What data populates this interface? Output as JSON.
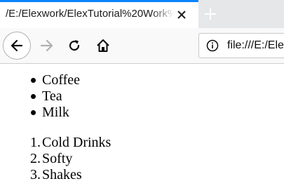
{
  "tab": {
    "title": "/E:/Elexwork/ElexTutorial%20Work%"
  },
  "urlbar": {
    "text": "file:///E:/Ele"
  },
  "page": {
    "unordered_list": [
      "Coffee",
      "Tea",
      "Milk"
    ],
    "ordered_list": [
      {
        "marker": "1.",
        "text": "Cold Drinks"
      },
      {
        "marker": "2.",
        "text": "Softy"
      },
      {
        "marker": "3.",
        "text": "Shakes"
      }
    ]
  },
  "icons": {
    "close": "close-icon",
    "new_tab": "plus-icon",
    "back": "arrow-left-icon",
    "forward": "arrow-right-icon",
    "reload": "reload-icon",
    "home": "home-icon",
    "info": "info-icon"
  },
  "colors": {
    "active_tab_accent": "#0a84ff",
    "tabstrip": "#e6e7e9",
    "toolbar": "#f9f9fa"
  }
}
